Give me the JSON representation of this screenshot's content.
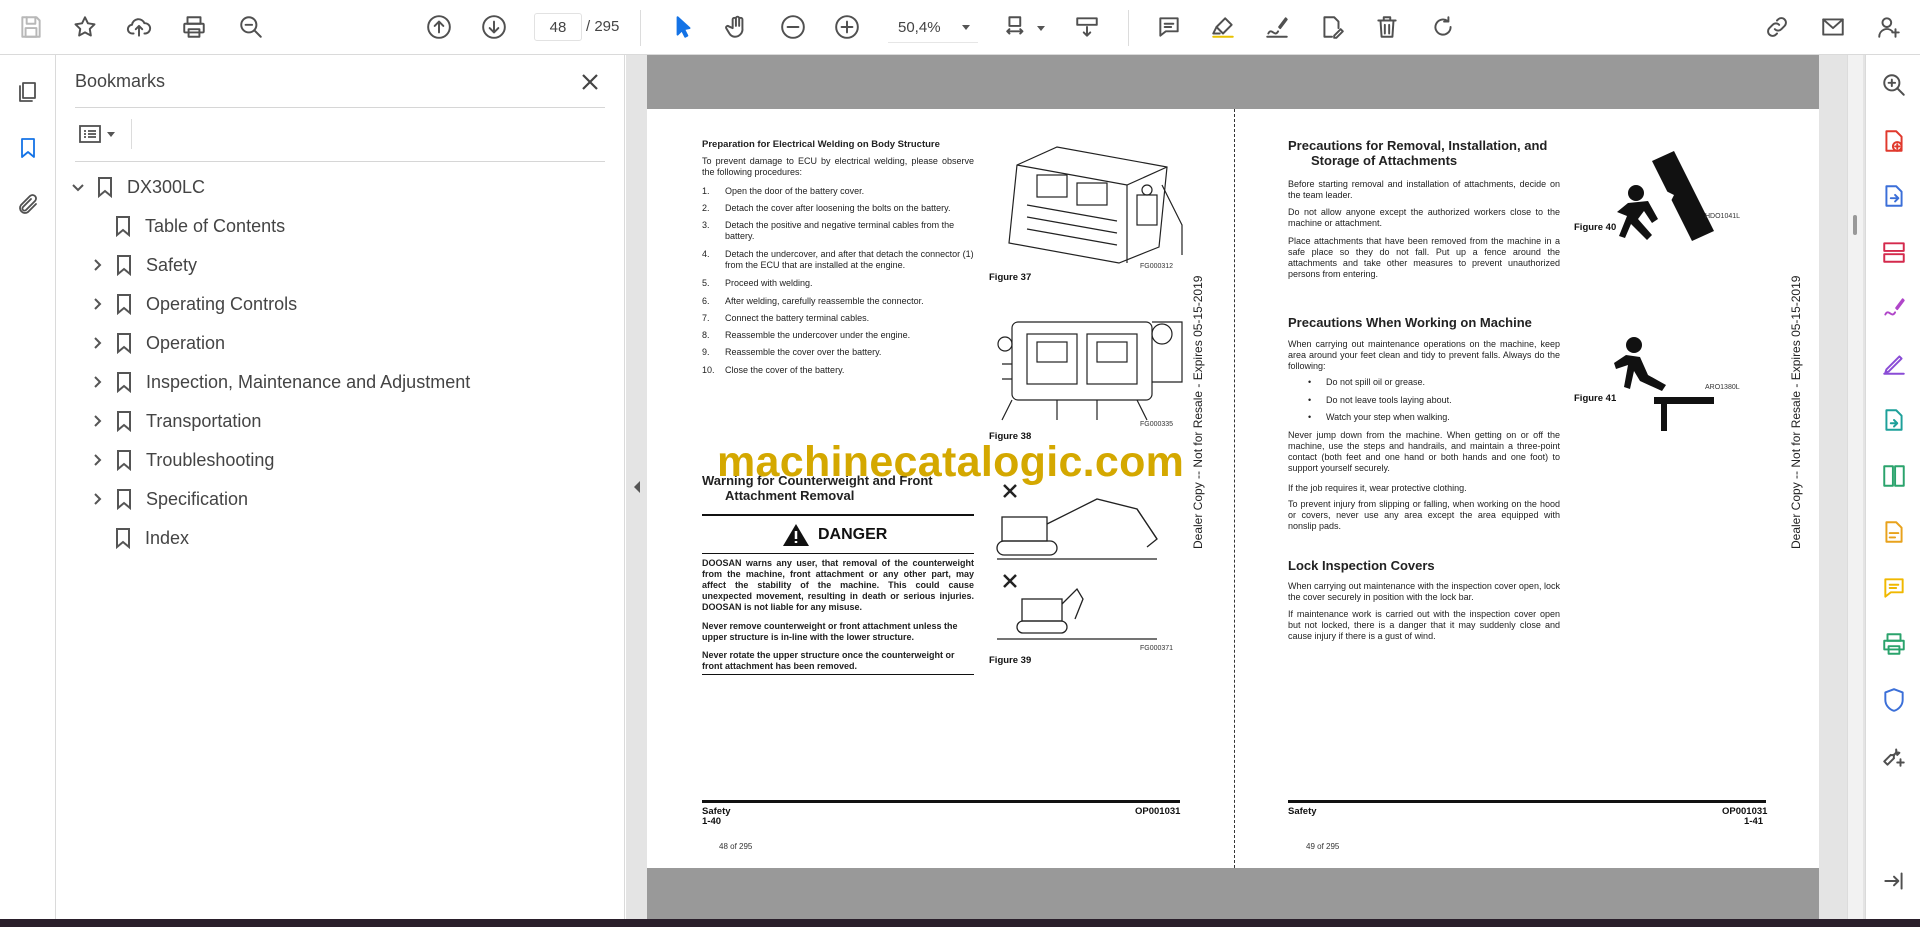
{
  "toolbar": {
    "page_current": "48",
    "page_total": "/  295",
    "zoom": "50,4%",
    "icons": [
      "save-icon",
      "bookmark-star-icon",
      "upload-icon",
      "print-icon",
      "search-zoom-icon",
      "prev-page-icon",
      "next-page-icon",
      "select-cursor-icon",
      "hand-icon",
      "zoom-out-icon",
      "zoom-in-icon",
      "page-fit-icon",
      "scroll-mode-icon",
      "comment-icon",
      "highlight-icon",
      "sign-icon",
      "edit-pdf-icon",
      "delete-icon",
      "rotate-icon",
      "share-link-icon",
      "mail-icon",
      "account-icon"
    ]
  },
  "left_rail": {
    "icons": [
      "thumbnails-icon",
      "bookmarks-icon",
      "attachments-icon"
    ]
  },
  "bookmarks_panel": {
    "title": "Bookmarks",
    "items": [
      {
        "label": "DX300LC",
        "level": 0,
        "expanded": true,
        "has_children": true
      },
      {
        "label": "Table of Contents",
        "level": 1,
        "has_children": false
      },
      {
        "label": "Safety",
        "level": 1,
        "has_children": true
      },
      {
        "label": "Operating Controls",
        "level": 1,
        "has_children": true
      },
      {
        "label": "Operation",
        "level": 1,
        "has_children": true
      },
      {
        "label": "Inspection, Maintenance and Adjustment",
        "level": 1,
        "has_children": true
      },
      {
        "label": "Transportation",
        "level": 1,
        "has_children": true
      },
      {
        "label": "Troubleshooting",
        "level": 1,
        "has_children": true
      },
      {
        "label": "Specification",
        "level": 1,
        "has_children": true
      },
      {
        "label": "Index",
        "level": 1,
        "has_children": false
      }
    ]
  },
  "watermark": "machinecatalogic.com",
  "left_page": {
    "heading1": "Preparation for Electrical Welding on Body Structure",
    "intro": "To prevent damage to ECU by electrical welding, please observe the following procedures:",
    "steps": [
      {
        "n": "1.",
        "t": "Open the door of the battery cover."
      },
      {
        "n": "2.",
        "t": "Detach the cover after loosening the bolts on the battery."
      },
      {
        "n": "3.",
        "t": "Detach the positive and negative terminal cables from the battery."
      },
      {
        "n": "4.",
        "t": "Detach the undercover, and after that detach the connector (1) from the ECU that are installed at the engine."
      },
      {
        "n": "5.",
        "t": "Proceed with welding."
      },
      {
        "n": "6.",
        "t": "After welding, carefully reassemble the connector."
      },
      {
        "n": "7.",
        "t": "Connect the battery terminal cables."
      },
      {
        "n": "8.",
        "t": "Reassemble the undercover under the engine."
      },
      {
        "n": "9.",
        "t": "Reassemble the cover over the battery."
      },
      {
        "n": "10.",
        "t": "Close the cover of the battery."
      }
    ],
    "heading2_line1": "Warning for Counterweight and Front",
    "heading2_line2": "Attachment Removal",
    "danger_label": "DANGER",
    "danger_p1": "DOOSAN warns any user, that removal of the counterweight from the machine, front attachment or any other part, may affect the stability of the machine. This could cause unexpected movement, resulting in death or serious injuries. DOOSAN is not liable for any misuse.",
    "danger_p2": "Never remove counterweight or front attachment unless the upper structure is in-line with the lower structure.",
    "danger_p3": "Never rotate the upper structure once the counterweight or front attachment has been removed.",
    "fig37": "Figure 37",
    "fig37_code": "FG000312",
    "fig38": "Figure 38",
    "fig38_code": "FG000335",
    "fig39": "Figure 39",
    "fig39_code": "FG000371",
    "vertical_note": "Dealer Copy -- Not for Resale - Expires 05-15-2019",
    "footer_left": "Safety",
    "footer_left2": "1-40",
    "footer_right": "OP001031",
    "page_of": "48 of 295"
  },
  "right_page": {
    "heading1_line1": "Precautions for Removal, Installation, and",
    "heading1_line2": "Storage of Attachments",
    "p1": "Before starting removal and installation of attachments, decide on the team leader.",
    "p2": "Do not allow anyone except the authorized workers close to the machine or attachment.",
    "p3": "Place attachments that have been removed from the machine in a safe place so they do not fall. Put up a fence around the attachments and take other measures to prevent unauthorized persons from entering.",
    "heading2": "Precautions When Working on Machine",
    "p4": "When carrying out maintenance operations on the machine, keep area around your feet clean and tidy to prevent falls. Always do the following:",
    "bullets": [
      "Do not spill oil or grease.",
      "Do not leave tools laying about.",
      "Watch your step when walking."
    ],
    "p5": "Never jump down from the machine. When getting on or off the machine, use the steps and handrails, and maintain a three-point contact (both feet and one hand or both hands and one foot) to support yourself securely.",
    "p6": "If the job requires it, wear protective clothing.",
    "p7": "To prevent injury from slipping or falling, when working on the hood or covers, never use any area except the area equipped with nonslip pads.",
    "heading3": "Lock Inspection Covers",
    "p8": "When carrying out maintenance with the inspection cover open, lock the cover securely in position with the lock bar.",
    "p9": "If maintenance work is carried out with the inspection cover open but not locked, there is a danger that it may suddenly close and cause injury if there is a gust of wind.",
    "fig40": "Figure 40",
    "fig40_code": "HDO1041L",
    "fig41": "Figure 41",
    "fig41_code": "ARO1380L",
    "vertical_note": "Dealer Copy -- Not for Resale - Expires 05-15-2019",
    "footer_left": "Safety",
    "footer_right": "OP001031",
    "footer_right2": "1-41",
    "page_of": "49 of 295"
  },
  "right_rail": {
    "icons": [
      {
        "name": "zoom-search-icon",
        "color": "#505050"
      },
      {
        "name": "create-pdf-icon",
        "color": "#e0392d"
      },
      {
        "name": "export-pdf-icon",
        "color": "#3b6fd8"
      },
      {
        "name": "organize-pages-icon",
        "color": "#d4294c"
      },
      {
        "name": "fill-sign-icon",
        "color": "#b046c9"
      },
      {
        "name": "sign-pen-icon",
        "color": "#8a4cd6"
      },
      {
        "name": "send-file-icon",
        "color": "#1da09a"
      },
      {
        "name": "compare-icon",
        "color": "#2aa36c"
      },
      {
        "name": "edit-file-icon",
        "color": "#e8a21c"
      },
      {
        "name": "comment-tool-icon",
        "color": "#f0b800"
      },
      {
        "name": "print-production-icon",
        "color": "#2aa36c"
      },
      {
        "name": "protect-icon",
        "color": "#3b6fd8"
      },
      {
        "name": "more-tools-icon",
        "color": "#505050"
      },
      {
        "name": "collapse-panel-icon",
        "color": "#505050"
      }
    ]
  }
}
